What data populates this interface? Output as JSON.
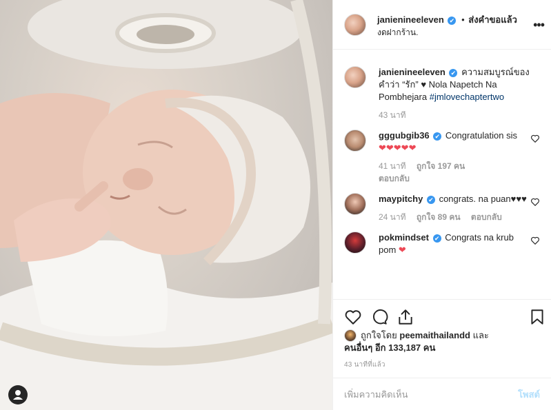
{
  "header": {
    "username": "janienineeleven",
    "verified_mark": "✔",
    "separator": "•",
    "follow_label": "ส่งคำขอแล้ว",
    "location": "งดฝากร้าน.",
    "more_label": "•••"
  },
  "caption": {
    "username": "janienineeleven",
    "text": "ความสมบูรณ์ของคำว่า “รัก” ♥ Nola Napetch Na Pombhejara",
    "hashtag": "#jmlovechaptertwo",
    "time": "43 นาที"
  },
  "comments": [
    {
      "username": "gggubgib36",
      "text": "Congratulation sis",
      "hearts": "❤❤❤❤❤",
      "time": "41 นาที",
      "likes": "ถูกใจ 197 คน",
      "reply": "ตอบกลับ"
    },
    {
      "username": "maypitchy",
      "text": "congrats. na puan♥♥♥",
      "time": "24 นาที",
      "likes": "ถูกใจ 89 คน",
      "reply": "ตอบกลับ"
    },
    {
      "username": "pokmindset",
      "text": "Congrats na krub pom",
      "hearts": "❤"
    }
  ],
  "likes": {
    "prefix": "ถูกใจโดย",
    "user": "peemaithailandd",
    "mid": "และ",
    "others": "คนอื่นๆ อีก 133,187 คน"
  },
  "time_ago": "43 นาทีที่แล้ว",
  "add_comment": {
    "placeholder": "เพิ่มความคิดเห็น",
    "post_label": "โพสต์"
  },
  "icons": {
    "like": "heart-outline-icon",
    "comment": "comment-bubble-icon",
    "share": "share-icon",
    "save": "bookmark-icon",
    "user_tag": "user-tag-icon"
  },
  "colors": {
    "verified": "#3897f0",
    "heart": "#ed4956",
    "hashtag": "#003569",
    "muted": "#999999"
  }
}
